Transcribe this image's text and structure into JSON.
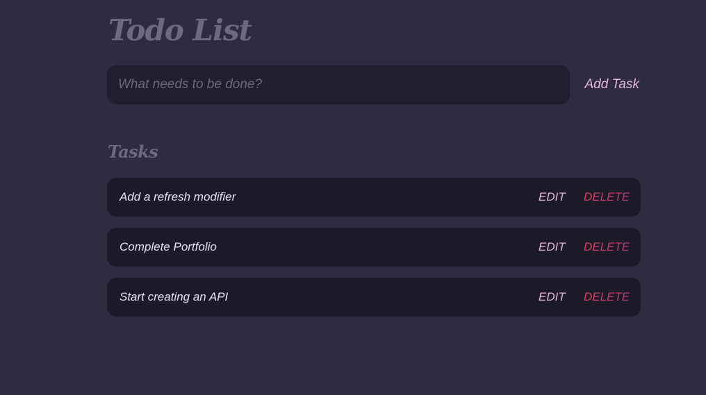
{
  "app": {
    "title": "Todo List"
  },
  "add_task": {
    "input_placeholder": "What needs to be done?",
    "input_value": "",
    "button_label": "Add Task"
  },
  "tasks_section": {
    "heading": "Tasks",
    "edit_label": "EDIT",
    "delete_label": "DELETE",
    "items": [
      {
        "text": "Add a refresh modifier"
      },
      {
        "text": "Complete Portfolio"
      },
      {
        "text": "Start creating an API"
      }
    ]
  },
  "colors": {
    "background": "#2f2c42",
    "input_background": "#201e2f",
    "card_background": "#1c1a29",
    "heading": "#6e6982",
    "accent_pink": "#e2b6df",
    "delete_red": "#e23f5c",
    "delete_purple": "#b03a76"
  }
}
